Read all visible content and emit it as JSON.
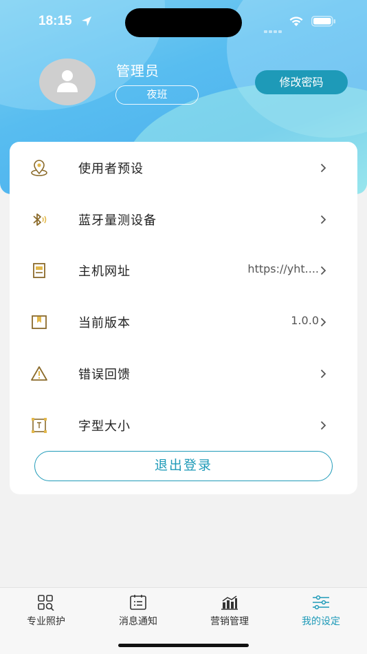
{
  "status_bar": {
    "time": "18:15"
  },
  "profile": {
    "name": "管理员",
    "shift": "夜班",
    "change_password": "修改密码"
  },
  "settings": [
    {
      "icon": "location-pin-icon",
      "label": "使用者预设",
      "value": ""
    },
    {
      "icon": "bluetooth-icon",
      "label": "蓝牙量测设备",
      "value": ""
    },
    {
      "icon": "server-icon",
      "label": "主机网址",
      "value": "https://yht...."
    },
    {
      "icon": "bookmark-icon",
      "label": "当前版本",
      "value": "1.0.0"
    },
    {
      "icon": "warning-icon",
      "label": "错误回馈",
      "value": ""
    },
    {
      "icon": "font-size-icon",
      "label": "字型大小",
      "value": ""
    }
  ],
  "logout_label": "退出登录",
  "tabs": [
    {
      "icon": "grid-search-icon",
      "label": "专业照护",
      "active": false
    },
    {
      "icon": "calendar-list-icon",
      "label": "消息通知",
      "active": false
    },
    {
      "icon": "bar-chart-icon",
      "label": "营销管理",
      "active": false
    },
    {
      "icon": "sliders-icon",
      "label": "我的设定",
      "active": true
    }
  ],
  "colors": {
    "accent": "#1e9ab8",
    "icon_gold": "#8a6a2a",
    "background": "#f2f2f2"
  }
}
